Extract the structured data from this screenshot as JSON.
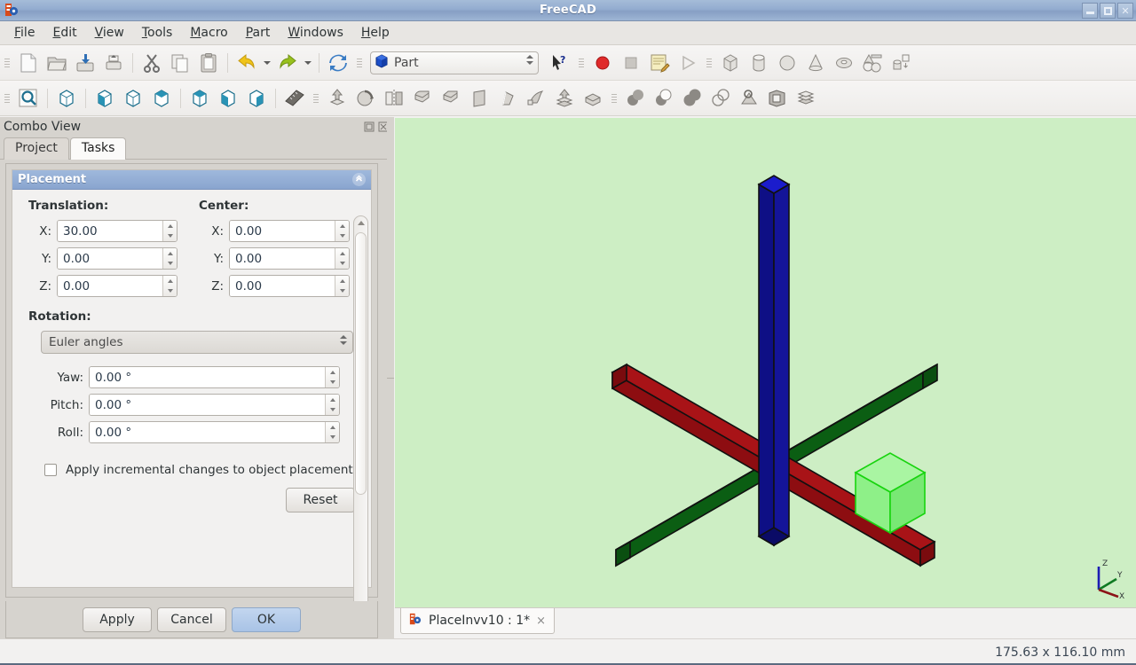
{
  "window": {
    "title": "FreeCAD",
    "app_icon": "freecad-logo-icon",
    "controls": {
      "minimize": "minimize-icon",
      "maximize": "maximize-icon",
      "close": "close-icon"
    }
  },
  "menubar": {
    "items": [
      {
        "label": "File",
        "mnemonic": "F"
      },
      {
        "label": "Edit",
        "mnemonic": "E"
      },
      {
        "label": "View",
        "mnemonic": "V"
      },
      {
        "label": "Tools",
        "mnemonic": "T"
      },
      {
        "label": "Macro",
        "mnemonic": "M"
      },
      {
        "label": "Part",
        "mnemonic": "P"
      },
      {
        "label": "Windows",
        "mnemonic": "W"
      },
      {
        "label": "Help",
        "mnemonic": "H"
      }
    ]
  },
  "toolbar_file": {
    "icons": [
      "new-document-icon",
      "open-folder-icon",
      "save-icon",
      "print-icon",
      "cut-scissors-icon",
      "copy-icon",
      "paste-icon",
      "undo-arrow-icon",
      "undo-dropdown-icon",
      "redo-arrow-icon",
      "redo-dropdown-icon",
      "refresh-icon"
    ]
  },
  "toolbar_workbench": {
    "selected": "Part",
    "icon": "part-cube-icon",
    "whats_this_icon": "whats-this-cursor-icon",
    "macro_icons": [
      "macro-record-icon",
      "macro-stop-icon",
      "macro-edit-icon",
      "macro-execute-icon"
    ]
  },
  "toolbar_primitives": {
    "icons": [
      "box-primitive-icon",
      "cylinder-primitive-icon",
      "sphere-primitive-icon",
      "cone-primitive-icon",
      "torus-primitive-icon",
      "shape-builder-icon",
      "primitives-dialog-icon"
    ]
  },
  "toolbar_view": {
    "icons": [
      "fit-all-icon",
      "axonometric-view-icon",
      "front-view-icon",
      "top-view-icon",
      "right-view-icon",
      "rear-view-icon",
      "bottom-view-icon",
      "left-view-icon",
      "measure-icon"
    ]
  },
  "toolbar_part": {
    "icons": [
      "extrude-icon",
      "revolve-icon",
      "mirror-icon",
      "fillet-icon",
      "chamfer-icon",
      "ruled-surface-icon",
      "loft-icon",
      "sweep-icon",
      "section-icon",
      "cross-sections-icon",
      "boolean-icon",
      "cut-icon",
      "union-icon",
      "common-icon",
      "check-geometry-icon",
      "boundbox-icon",
      "compound-icon"
    ]
  },
  "dock": {
    "title": "Combo View",
    "float_icon": "undock-icon",
    "close_icon": "close-panel-icon",
    "tabs": [
      {
        "label": "Project",
        "active": false
      },
      {
        "label": "Tasks",
        "active": true
      }
    ],
    "scrollbar": {
      "up_icon": "scroll-up-icon",
      "down_icon": "scroll-down-icon"
    }
  },
  "placement": {
    "title": "Placement",
    "collapse_icon": "collapse-chevron-icon",
    "translation": {
      "label": "Translation:",
      "fields": [
        {
          "axis": "X:",
          "value": "30.00"
        },
        {
          "axis": "Y:",
          "value": "0.00"
        },
        {
          "axis": "Z:",
          "value": "0.00"
        }
      ]
    },
    "center": {
      "label": "Center:",
      "fields": [
        {
          "axis": "X:",
          "value": "0.00"
        },
        {
          "axis": "Y:",
          "value": "0.00"
        },
        {
          "axis": "Z:",
          "value": "0.00"
        }
      ]
    },
    "rotation": {
      "label": "Rotation:",
      "mode": "Euler angles",
      "fields": [
        {
          "label": "Yaw:",
          "value": "0.00 °"
        },
        {
          "label": "Pitch:",
          "value": "0.00 °"
        },
        {
          "label": "Roll:",
          "value": "0.00 °"
        }
      ]
    },
    "incremental": {
      "label": "Apply incremental changes to object placement",
      "checked": false
    },
    "reset_label": "Reset"
  },
  "dialog_buttons": {
    "apply": "Apply",
    "cancel": "Cancel",
    "ok": "OK"
  },
  "view3d": {
    "background_color": "#cdeec4",
    "axes": [
      {
        "name": "x-axis-bar",
        "color": "#9e0f13"
      },
      {
        "name": "y-axis-bar",
        "color": "#0c6a16"
      },
      {
        "name": "z-axis-bar",
        "color": "#11129c"
      }
    ],
    "object": {
      "name": "selected-box-solid",
      "fill": "#95f08f",
      "edge": "#18d40f"
    },
    "navigation_cube": {
      "labels": [
        "Z",
        "Y",
        "X"
      ],
      "colors": {
        "z": "#1c1cb4",
        "y": "#0f7a22",
        "x": "#8b1418"
      }
    }
  },
  "document_tabs": [
    {
      "icon": "freecad-doc-icon",
      "label": "PlaceInvv10 : 1*",
      "close": "×"
    }
  ],
  "statusbar": {
    "dimensions": "175.63 x 116.10 mm"
  }
}
